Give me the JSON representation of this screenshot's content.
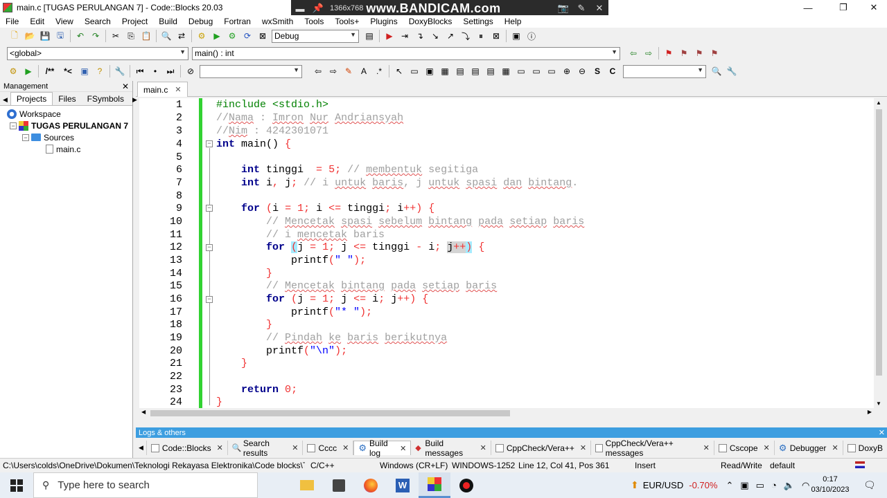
{
  "window": {
    "title": "main.c [TUGAS PERULANGAN 7] - Code::Blocks 20.03",
    "min_icon": "—",
    "max_icon": "❐",
    "close_icon": "✕"
  },
  "bandicam": {
    "resolution": "1366x768",
    "logo": "www.BANDICAM.com"
  },
  "menu": [
    "File",
    "Edit",
    "View",
    "Search",
    "Project",
    "Build",
    "Debug",
    "Fortran",
    "wxSmith",
    "Tools",
    "Tools+",
    "Plugins",
    "DoxyBlocks",
    "Settings",
    "Help"
  ],
  "toolbar": {
    "build_target": "Debug",
    "scope": "<global>",
    "function": "main() : int",
    "combo3": "",
    "combo4": ""
  },
  "management": {
    "title": "Management",
    "tabs": [
      "Projects",
      "Files",
      "FSymbols"
    ],
    "workspace": "Workspace",
    "project": "TUGAS PERULANGAN 7",
    "sources": "Sources",
    "file": "main.c"
  },
  "editor": {
    "tab_label": "main.c",
    "line_numbers": [
      "1",
      "2",
      "3",
      "4",
      "5",
      "6",
      "7",
      "8",
      "9",
      "10",
      "11",
      "12",
      "13",
      "14",
      "15",
      "16",
      "17",
      "18",
      "19",
      "20",
      "21",
      "22",
      "23",
      "24"
    ]
  },
  "logs": {
    "title": "Logs & others",
    "tabs": [
      "Code::Blocks",
      "Search results",
      "Cccc",
      "Build log",
      "Build messages",
      "CppCheck/Vera++",
      "CppCheck/Vera++ messages",
      "Cscope",
      "Debugger",
      "DoxyB"
    ]
  },
  "status": {
    "path": "C:\\Users\\colds\\OneDrive\\Dokumen\\Teknologi Rekayasa Elektronika\\Code blocks\\TUG...",
    "language": "C/C++",
    "line_endings": "Windows (CR+LF)",
    "encoding": "WINDOWS-1252",
    "position": "Line 12, Col 41, Pos 361",
    "mode": "Insert",
    "access": "Read/Write",
    "profile": "default"
  },
  "taskbar": {
    "search_placeholder": "Type here to search",
    "currency": "EUR/USD",
    "change": "-0.70%",
    "time": "0:17",
    "date": "03/10/2023"
  },
  "colors": {
    "keyword": "#00008b",
    "preprocessor": "#008000",
    "number": "#f03030",
    "string": "#0000ff",
    "comment": "#a0a0a0",
    "change_bar": "#32d232",
    "logs_header": "#3d9ee0"
  }
}
